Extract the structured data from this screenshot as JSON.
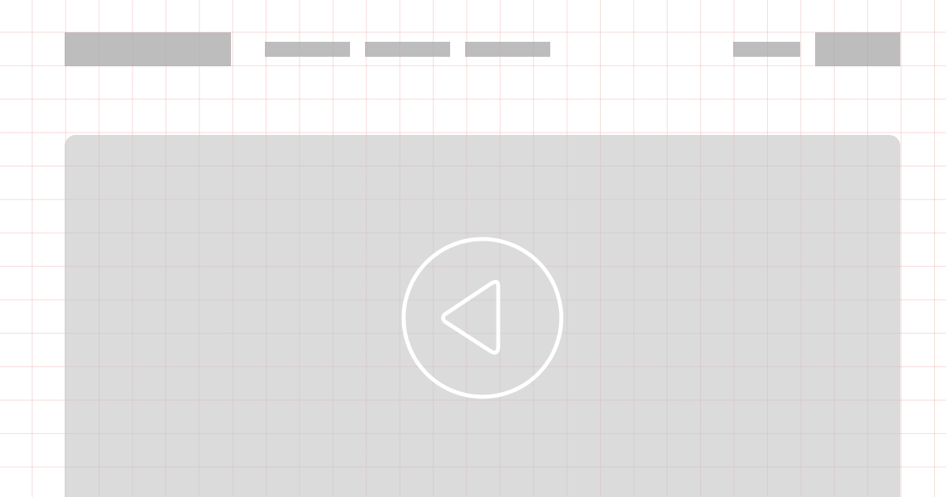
{
  "header": {
    "logo_icon": "logo-placeholder",
    "nav_items": [
      "",
      "",
      ""
    ],
    "login_icon": "text-placeholder",
    "cta_icon": "button-placeholder"
  },
  "hero": {
    "media_icon": "video-placeholder",
    "play_icon": "play-icon"
  },
  "colors": {
    "background": "#ffffff",
    "placeholder_block": "#bcbcbc",
    "media_block": "#d8d8d8",
    "icon_stroke": "#ffffff",
    "grid_line": "#f1d6d6"
  }
}
